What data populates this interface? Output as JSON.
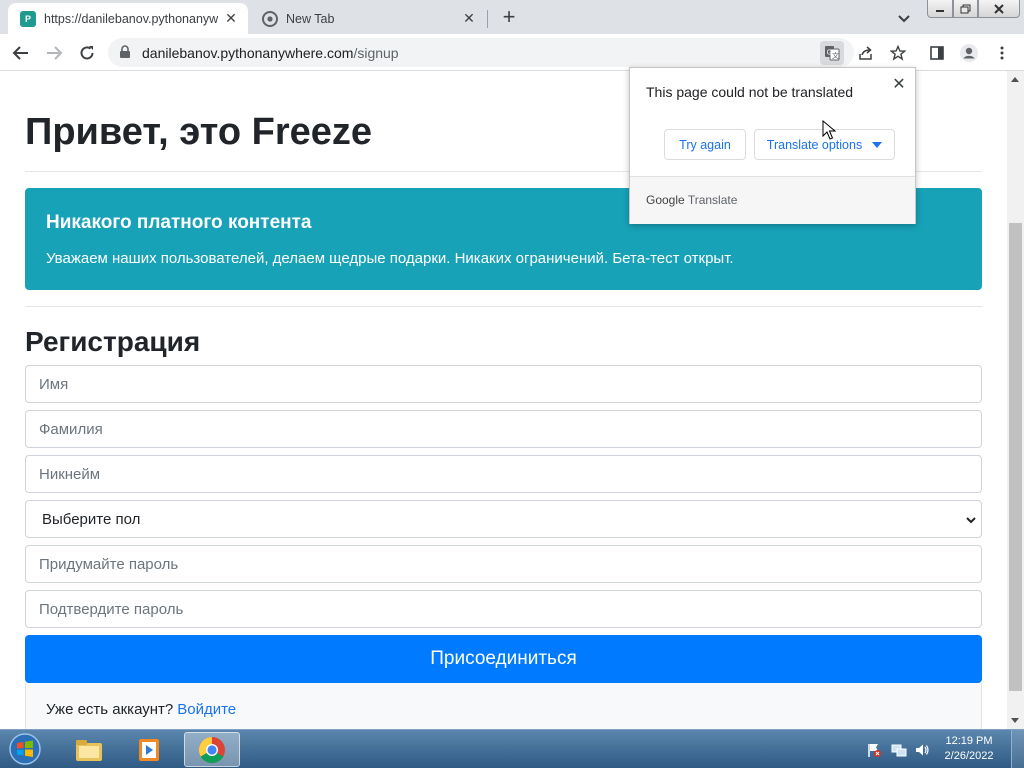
{
  "browser": {
    "tabs": [
      {
        "title": "https://danilebanov.pythonanyw",
        "active": true
      },
      {
        "title": "New Tab",
        "active": false
      }
    ],
    "address": {
      "host": "danilebanov.pythonanywhere.com",
      "path": "/signup"
    }
  },
  "translate_bubble": {
    "message": "This page could not be translated",
    "try_again": "Try again",
    "options": "Translate options",
    "brand_google": "Google",
    "brand_translate": "Translate"
  },
  "page": {
    "heading": "Привет, это Freeze",
    "alert": {
      "title": "Никакого платного контента",
      "text": "Уважаем наших пользователей, делаем щедрые подарки. Никаких ограничений. Бета-тест открыт."
    },
    "form": {
      "title": "Регистрация",
      "first_name_placeholder": "Имя",
      "last_name_placeholder": "Фамилия",
      "nickname_placeholder": "Никнейм",
      "gender_selected": "Выберите пол",
      "password_placeholder": "Придумайте пароль",
      "confirm_placeholder": "Подтвердите пароль",
      "submit": "Присоединиться"
    },
    "login": {
      "text": "Уже есть аккаунт?",
      "link": "Войдите"
    }
  },
  "taskbar": {
    "time": "12:19 PM",
    "date": "2/26/2022"
  },
  "colors": {
    "alert": "#17a2b8",
    "primary": "#007bff",
    "link": "#1a73e8"
  }
}
